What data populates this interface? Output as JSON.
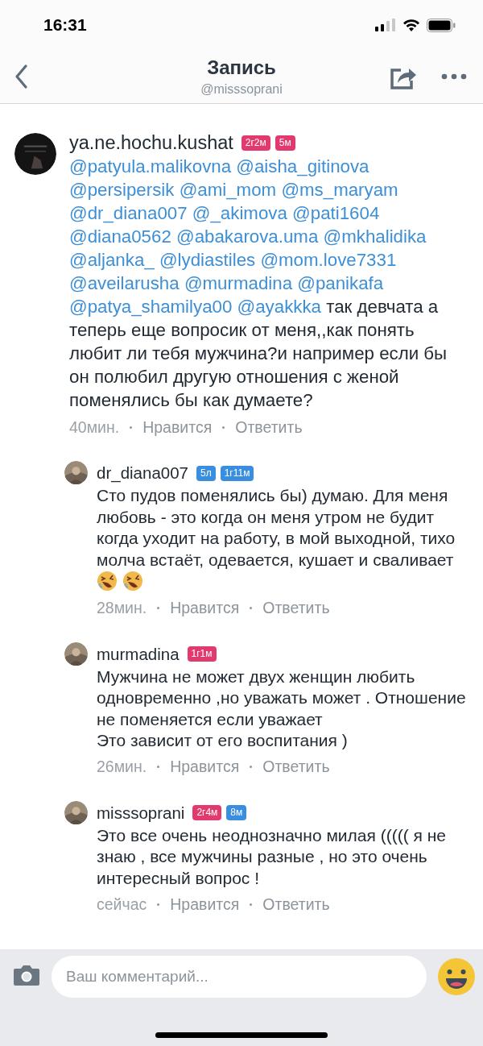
{
  "status_bar": {
    "time": "16:31"
  },
  "header": {
    "title": "Запись",
    "subtitle": "@misssoprani"
  },
  "comments": [
    {
      "kind": "post",
      "author": "ya.ne.hochu.kushat",
      "badges": [
        {
          "text": "2г2м",
          "color": "#e23a6e"
        },
        {
          "text": "5м",
          "color": "#e23a6e"
        }
      ],
      "mentions": [
        "@patyula.malikovna",
        "@aisha_gitinova",
        "@persipersik",
        "@ami_mom",
        "@ms_maryam",
        "@dr_diana007",
        "@_akimova",
        "@pati1604",
        "@diana0562",
        "@abakarova.uma",
        "@mkhalidika",
        "@aljanka_",
        "@lydiastiles",
        "@mom.love7331",
        "@aveilarusha",
        "@murmadina",
        "@panikafa",
        "@patya_shamilya00",
        "@ayakkka"
      ],
      "text": "так девчата а теперь еще вопросик от меня,,как понять любит ли тебя мужчина?и например если бы он полюбил другую отношения с женой поменялись бы как думаете?",
      "time": "40мин.",
      "like": "Нравится",
      "reply": "Ответить"
    },
    {
      "kind": "reply",
      "author": "dr_diana007",
      "badges": [
        {
          "text": "5л",
          "color": "#3a8ee0"
        },
        {
          "text": "1г11м",
          "color": "#3a8ee0"
        }
      ],
      "text": "Сто пудов поменялись бы) думаю. Для меня любовь - это когда он меня утром не будит когда уходит на работу, в мой выходной, тихо молча встаёт, одевается, кушает и сваливает",
      "emojis": [
        {
          "kind": "rofl"
        },
        {
          "kind": "rofl"
        }
      ],
      "time": "28мин.",
      "like": "Нравится",
      "reply": "Ответить"
    },
    {
      "kind": "reply",
      "author": "murmadina",
      "badges": [
        {
          "text": "1г1м",
          "color": "#e23a6e"
        }
      ],
      "text": "Мужчина не может двух женщин любить одновременно ,но уважать может . Отношение не поменяется если уважает\nЭто зависит от его воспитания )",
      "time": "26мин.",
      "like": "Нравится",
      "reply": "Ответить"
    },
    {
      "kind": "reply",
      "author": "misssoprani",
      "badges": [
        {
          "text": "2г4м",
          "color": "#e23a6e"
        },
        {
          "text": "8м",
          "color": "#3a8ee0"
        }
      ],
      "text": "Это все очень неоднозначно милая ((((( я не знаю , все мужчины разные , но это очень интересный вопрос !",
      "time": "сейчас",
      "like": "Нравится",
      "reply": "Ответить"
    }
  ],
  "composer": {
    "placeholder": "Ваш комментарий..."
  }
}
